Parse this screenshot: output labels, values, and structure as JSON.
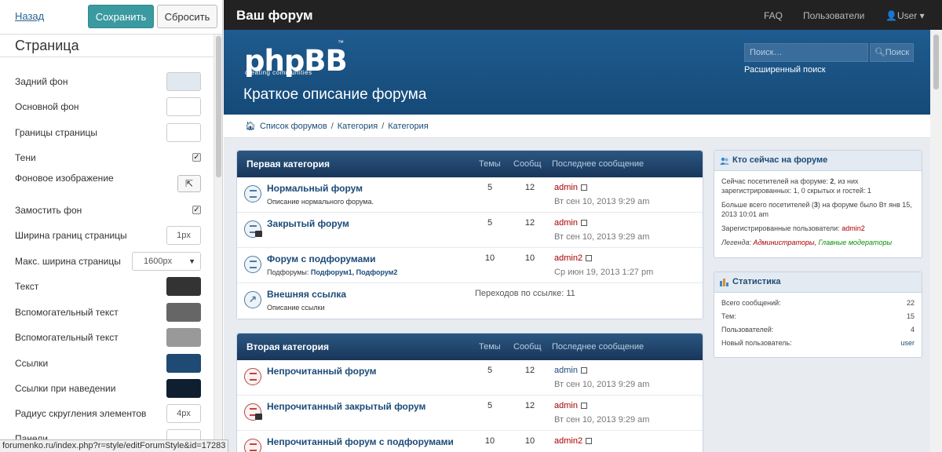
{
  "editor": {
    "back_label": "Назад",
    "save_label": "Сохранить",
    "reset_label": "Сбросить",
    "section_title": "Страница",
    "options": [
      {
        "label": "Задний фон",
        "control": "color",
        "value": "#e2e8f0"
      },
      {
        "label": "Основной фон",
        "control": "color",
        "value": "#ffffff"
      },
      {
        "label": "Границы страницы",
        "control": "color",
        "value": "#ffffff"
      },
      {
        "label": "Тени",
        "control": "checkbox",
        "checked": true
      },
      {
        "label": "Фоновое изображение",
        "control": "image-button"
      },
      {
        "label": "Замостить фон",
        "control": "checkbox",
        "checked": true
      },
      {
        "label": "Ширина границ страницы",
        "control": "number",
        "value": "1px"
      },
      {
        "label": "Макс. ширина страницы",
        "control": "select",
        "value": "1600px"
      },
      {
        "label": "Текст",
        "control": "color",
        "value": "#333333"
      },
      {
        "label": "Вспомогательный текст",
        "control": "color",
        "value": "#666666"
      },
      {
        "label": "Вспомогательный текст",
        "control": "color",
        "value": "#999999"
      },
      {
        "label": "Ссылки",
        "control": "color",
        "value": "#1e4a74"
      },
      {
        "label": "Ссылки при наведении",
        "control": "color",
        "value": "#0f1f30"
      },
      {
        "label": "Радиус скругления элементов",
        "control": "number",
        "value": "4px"
      },
      {
        "label": "Панели",
        "control": "color",
        "value": "#ffffff"
      }
    ],
    "status_url": "forumenko.ru/index.php?r=style/editForumStyle&id=17283"
  },
  "navbar": {
    "brand": "Ваш форум",
    "faq": "FAQ",
    "users": "Пользователи",
    "user": "User"
  },
  "header": {
    "logo": "phpBB",
    "logo_sub": "creating  communities",
    "logo_tm": "™",
    "tagline": "Краткое описание форума",
    "search_placeholder": "Поиск…",
    "search_button": "Поиск",
    "advanced_search": "Расширенный поиск"
  },
  "breadcrumb": [
    "Список форумов",
    "Категория",
    "Категория"
  ],
  "columns": {
    "topics": "Темы",
    "posts": "Сообщ",
    "last": "Последнее сообщение"
  },
  "categories": [
    {
      "name": "Первая категория",
      "forums": [
        {
          "name": "Нормальный форум",
          "desc": "Описание нормального форума.",
          "topics": "5",
          "posts": "12",
          "author": "admin",
          "date": "Вт сен 10, 2013 9:29 am"
        },
        {
          "name": "Закрытый форум",
          "desc": "",
          "topics": "5",
          "posts": "12",
          "author": "admin",
          "date": "Вт сен 10, 2013 9:29 am"
        },
        {
          "name": "Форум с подфорумами",
          "desc_prefix": "Подфорумы:",
          "subforums": "Подфорум1, Подфорум2",
          "topics": "10",
          "posts": "10",
          "author": "admin2",
          "date": "Ср июн 19, 2013 1:27 pm"
        },
        {
          "name": "Внешняя ссылка",
          "desc": "Описание ссылки",
          "redirects": "Переходов по ссылке: 11"
        }
      ]
    },
    {
      "name": "Вторая категория",
      "forums": [
        {
          "name": "Непрочитанный форум",
          "topics": "5",
          "posts": "12",
          "author": "admin",
          "date": "Вт сен 10, 2013 9:29 am"
        },
        {
          "name": "Непрочитанный закрытый форум",
          "topics": "5",
          "posts": "12",
          "author": "admin",
          "date": "Вт сен 10, 2013 9:29 am"
        },
        {
          "name": "Непрочитанный форум с подфорумами",
          "topics": "10",
          "posts": "10",
          "author": "admin2"
        }
      ]
    }
  ],
  "who_online": {
    "title": "Кто сейчас на форуме",
    "line1_a": "Сейчас посетителей на форуме: ",
    "line1_b": "2",
    "line1_c": ", из них зарегистрированных: 1, 0 скрытых и гостей: 1",
    "line2_a": "Больше всего посетителей (",
    "line2_b": "3",
    "line2_c": ") на форуме было Вт янв 15, 2013 10:01 am",
    "registered_label": "Зарегистрированные пользователи: ",
    "registered_user": "admin2",
    "legend_label": "Легенда: ",
    "legend_admins": "Администраторы",
    "legend_sep": ", ",
    "legend_mods": "Главные модераторы"
  },
  "stats": {
    "title": "Статистика",
    "rows": [
      {
        "label": "Всего сообщений:",
        "value": "22"
      },
      {
        "label": "Тем:",
        "value": "15"
      },
      {
        "label": "Пользователей:",
        "value": "4"
      },
      {
        "label": "Новый пользователь:",
        "value": "user"
      }
    ]
  }
}
